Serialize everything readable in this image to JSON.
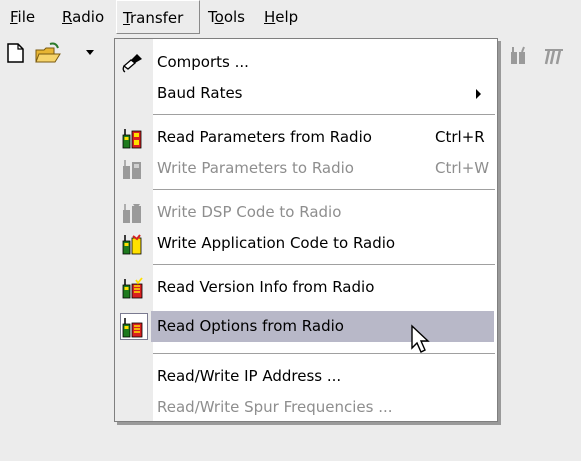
{
  "menubar": {
    "items": [
      {
        "label": "File"
      },
      {
        "label": "Radio"
      },
      {
        "label": "Transfer"
      },
      {
        "label": "Tools"
      },
      {
        "label": "Help"
      }
    ]
  },
  "transfer_menu": {
    "comports": "Comports ...",
    "baud_rates": "Baud Rates",
    "read_params": "Read Parameters from Radio",
    "read_params_shortcut": "Ctrl+R",
    "write_params": "Write Parameters to Radio",
    "write_params_shortcut": "Ctrl+W",
    "write_dsp": "Write DSP Code to Radio",
    "write_app": "Write Application Code to Radio",
    "read_version": "Read Version Info from Radio",
    "read_options": "Read Options from Radio",
    "rw_ip": "Read/Write IP Address ...",
    "rw_spur": "Read/Write Spur Frequencies ..."
  },
  "colors": {
    "menu_bg": "#ececec",
    "highlight": "#b8b8c8",
    "disabled_text": "#8e8e8e"
  },
  "icons": [
    "new-document-icon",
    "open-folder-icon",
    "comport-plug-icon",
    "radio-icon",
    "mouse-cursor-icon"
  ]
}
